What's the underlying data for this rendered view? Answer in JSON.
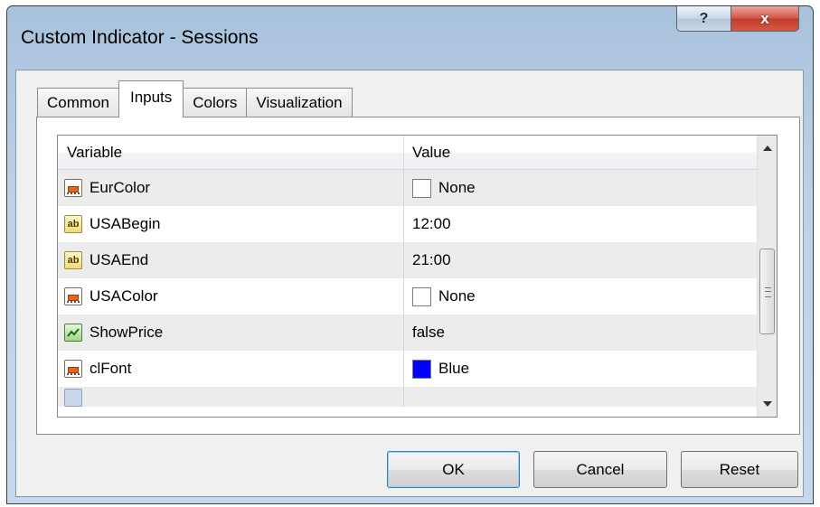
{
  "window": {
    "title": "Custom Indicator - Sessions",
    "help_glyph": "?",
    "close_glyph": "x"
  },
  "tabs": [
    {
      "label": "Common",
      "active": false
    },
    {
      "label": "Inputs",
      "active": true
    },
    {
      "label": "Colors",
      "active": false
    },
    {
      "label": "Visualization",
      "active": false
    }
  ],
  "grid": {
    "headers": {
      "variable": "Variable",
      "value": "Value"
    },
    "rows": [
      {
        "icon": "color-param-icon",
        "variable": "EurColor",
        "value": "None",
        "swatch": "#ffffff"
      },
      {
        "icon": "string-param-icon",
        "icon_text": "ab",
        "variable": "USABegin",
        "value": "12:00"
      },
      {
        "icon": "string-param-icon",
        "icon_text": "ab",
        "variable": "USAEnd",
        "value": "21:00"
      },
      {
        "icon": "color-param-icon",
        "variable": "USAColor",
        "value": "None",
        "swatch": "#ffffff"
      },
      {
        "icon": "bool-param-icon",
        "variable": "ShowPrice",
        "value": "false"
      },
      {
        "icon": "color-param-icon",
        "variable": "clFont",
        "value": "Blue",
        "swatch": "#0000ff"
      }
    ],
    "scroll_position": 0.55
  },
  "buttons": {
    "ok": "OK",
    "cancel": "Cancel",
    "reset": "Reset"
  },
  "colors": {
    "accent": "#3c7fb1",
    "close": "#c23b2e",
    "swatch_blue": "#0000ff"
  }
}
